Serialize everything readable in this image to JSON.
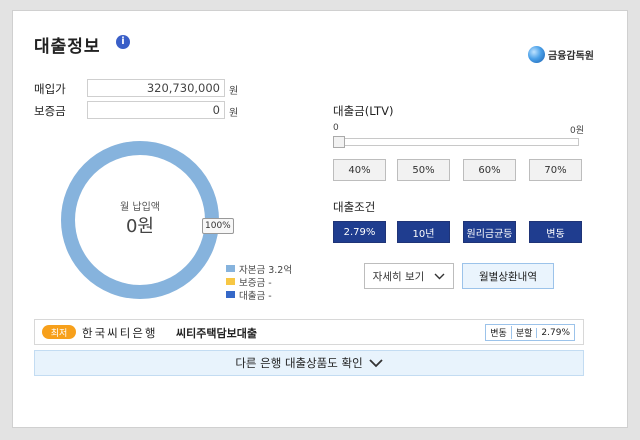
{
  "header": {
    "title": "대출정보",
    "info_icon": "i",
    "logo_text": "금융감독원"
  },
  "inputs": {
    "purchase_label": "매입가",
    "purchase_value": "320,730,000",
    "purchase_unit": "원",
    "deposit_label": "보증금",
    "deposit_value": "0",
    "deposit_unit": "원"
  },
  "donut": {
    "label": "월 납입액",
    "value": "0원",
    "percent_badge": "100%",
    "ring_fraction": 1.0,
    "ring_color": "#86b3dd"
  },
  "legend": [
    {
      "label": "자본금 3.2억",
      "color": "#86b3dd"
    },
    {
      "label": "보증금 -",
      "color": "#f7c744"
    },
    {
      "label": "대출금 -",
      "color": "#3568c8"
    }
  ],
  "ltv": {
    "label": "대출금(LTV)",
    "min_label": "0",
    "max_label": "0원",
    "slider_value": 0,
    "buttons": [
      "40%",
      "50%",
      "60%",
      "70%"
    ]
  },
  "conditions": {
    "label": "대출조건",
    "buttons": [
      "2.79%",
      "10년",
      "원리금균등",
      "변동"
    ]
  },
  "actions": {
    "detail_label": "자세히 보기",
    "monthly_label": "월별상환내역"
  },
  "bank": {
    "badge": "최저",
    "bank_name": "한국씨티은행",
    "product": "씨티주택담보대출",
    "tags": [
      "변동",
      "분할",
      "2.79%"
    ]
  },
  "other": {
    "label": "다른 은행 대출상품도 확인"
  },
  "colors": {
    "accent": "#1f3d8f",
    "badge": "#f7a01b",
    "info": "#3a5fc8"
  }
}
